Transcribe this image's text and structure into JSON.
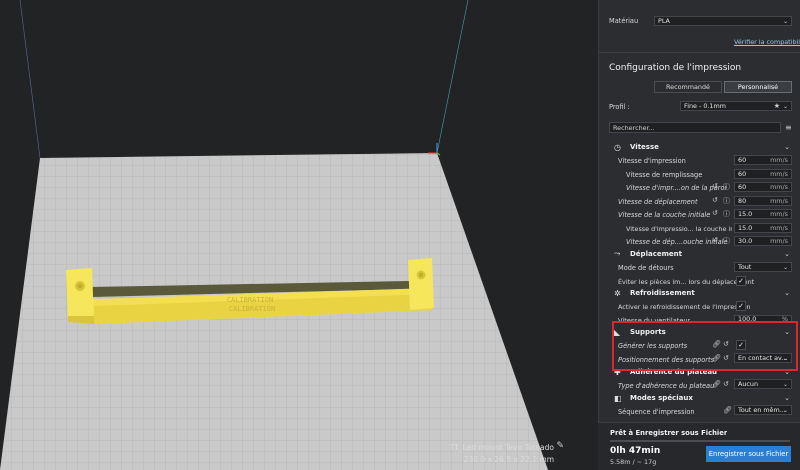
{
  "material": {
    "label": "Matériau",
    "value": "PLA",
    "link": "Vérifier la compatibilité"
  },
  "config": {
    "title": "Configuration de l'impression",
    "tab_recommended": "Recommandé",
    "tab_custom": "Personnalisé"
  },
  "profile": {
    "label": "Profil :",
    "value": "Fine - 0.1mm"
  },
  "search": {
    "placeholder": "Rechercher..."
  },
  "sections": {
    "speed": "Vitesse",
    "travel": "Déplacement",
    "cooling": "Refroidissement",
    "supports": "Supports",
    "adhesion": "Adhérence du plateau",
    "special": "Modes spéciaux"
  },
  "settings": {
    "print_speed": {
      "label": "Vitesse d'impression",
      "value": "60",
      "unit": "mm/s"
    },
    "infill_speed": {
      "label": "Vitesse de remplissage",
      "value": "60",
      "unit": "mm/s"
    },
    "wall_speed": {
      "label": "Vitesse d'impr....on de la paroi",
      "value": "60",
      "unit": "mm/s"
    },
    "travel_speed": {
      "label": "Vitesse de déplacement",
      "value": "80",
      "unit": "mm/s"
    },
    "initial_layer_speed": {
      "label": "Vitesse de la couche initiale",
      "value": "15.0",
      "unit": "mm/s"
    },
    "initial_layer_print_speed": {
      "label": "Vitesse d'impressio... la couche initiale",
      "value": "15.0",
      "unit": "mm/s"
    },
    "initial_layer_travel_speed": {
      "label": "Vitesse de dép....ouche initiale",
      "value": "30.0",
      "unit": "mm/s"
    },
    "combing_mode": {
      "label": "Mode de détours",
      "value": "Tout"
    },
    "avoid_printed": {
      "label": "Éviter les pièces im... lors du déplacement"
    },
    "enable_cooling": {
      "label": "Activer le refroidissement de l'impression"
    },
    "fan_speed": {
      "label": "Vitesse du ventilateur",
      "value": "100.0",
      "unit": "%"
    },
    "generate_supports": {
      "label": "Générer les supports"
    },
    "support_placement": {
      "label": "Positionnement des supports",
      "value": "En contact av..."
    },
    "adhesion_type": {
      "label": "Type d'adhérence du plateau",
      "value": "Aucun"
    },
    "print_sequence": {
      "label": "Séquence d'impression",
      "value": "Tout en mêm..."
    }
  },
  "footer": {
    "status": "Prêt à Enregistrer sous Fichier",
    "time": "0lh 47min",
    "material_use": "5.58m / ~ 17g",
    "save": "Enregistrer sous Fichier"
  },
  "model": {
    "name": "TT_Led mount Tevo Tornado",
    "dims": "230.0 x 26.5 x 22.1 mm",
    "engraved_text": "CALIBRATION"
  },
  "colors": {
    "accent": "#2a7fd4",
    "highlight": "#d72b2b",
    "model": "#f5e45a",
    "bed": "#c5c5c5"
  },
  "icons": {
    "speed": "clock-icon",
    "travel": "travel-icon",
    "cooling": "fan-icon",
    "supports": "support-icon",
    "adhesion": "adhesion-icon",
    "special": "special-icon",
    "link": "link-icon",
    "reset": "reset-icon",
    "info": "info-icon",
    "star": "star-icon",
    "menu": "menu-icon",
    "edit": "pencil-icon"
  }
}
